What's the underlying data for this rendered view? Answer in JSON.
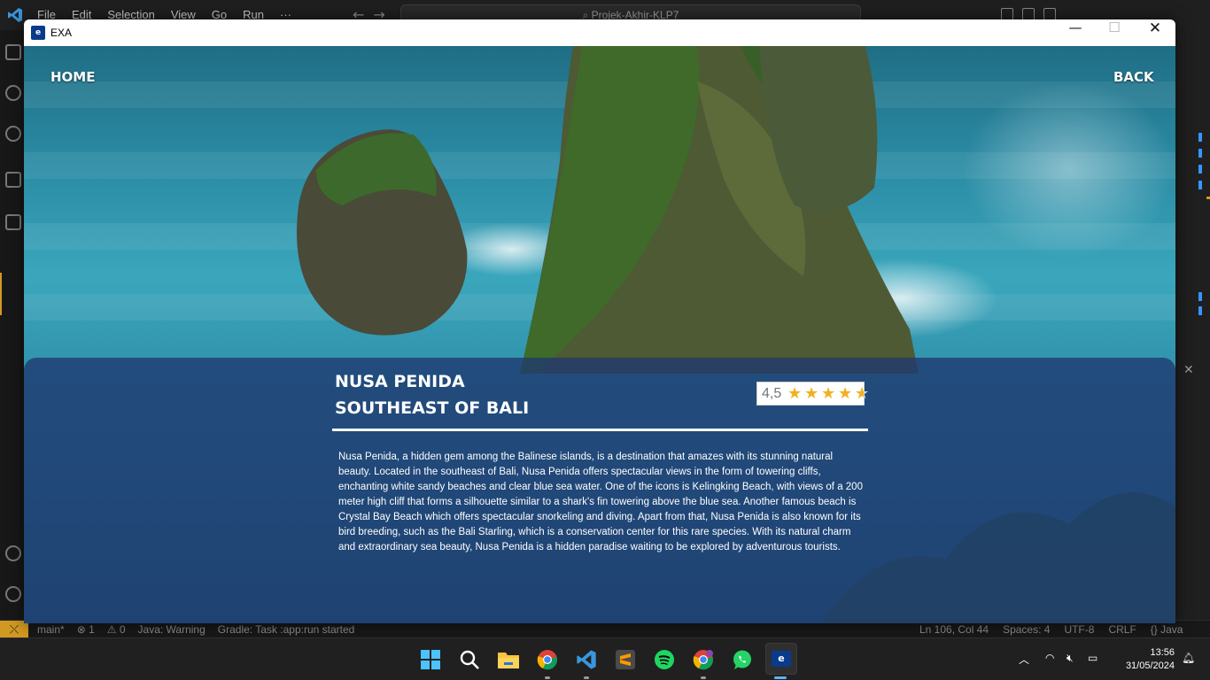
{
  "vscode": {
    "menu": [
      "File",
      "Edit",
      "Selection",
      "View",
      "Go",
      "Run",
      "···"
    ],
    "search_text": "Projek-Akhir-KLP7",
    "status_left": [
      "main*",
      "⊗ 1",
      "⚠ 0",
      "Java: Warning",
      "Gradle: Task :app:run started"
    ],
    "status_right": [
      "Ln 106, Col 44",
      "Spaces: 4",
      "UTF-8",
      "CRLF",
      "{} Java"
    ]
  },
  "app": {
    "window_title": "EXA",
    "nav": {
      "home": "HOME",
      "back": "BACK"
    },
    "destination": {
      "name": "NUSA PENIDA",
      "region": "SOUTHEAST OF BALI",
      "rating_value": "4,5",
      "rating": 4.5,
      "rating_max": 5,
      "description": "Nusa Penida, a hidden gem among the Balinese islands, is a destination that amazes with its stunning natural beauty. Located in the southeast of Bali, Nusa Penida offers spectacular views in the form of towering cliffs, enchanting white sandy beaches and clear blue sea water. One of the icons is Kelingking Beach, with views of a 200 meter high cliff that forms a silhouette similar to a shark's fin towering above the blue sea. Another famous beach is Crystal Bay Beach which offers spectacular snorkeling and diving. Apart from that, Nusa Penida is also known for its bird breeding, such as the Bali Starling, which is a conservation center for this rare species. With its natural charm and extraordinary sea beauty, Nusa Penida is a hidden paradise waiting to be explored by adventurous tourists."
    }
  },
  "taskbar": {
    "apps": [
      "windows-start",
      "search",
      "file-explorer",
      "chrome",
      "vscode",
      "sublime-text",
      "spotify",
      "chrome-profile",
      "whatsapp",
      "exa"
    ],
    "time": "13:56",
    "date": "31/05/2024"
  },
  "colors": {
    "panel": "#1f3870",
    "star": "#f2b01e",
    "status_accent": "#d29922"
  }
}
